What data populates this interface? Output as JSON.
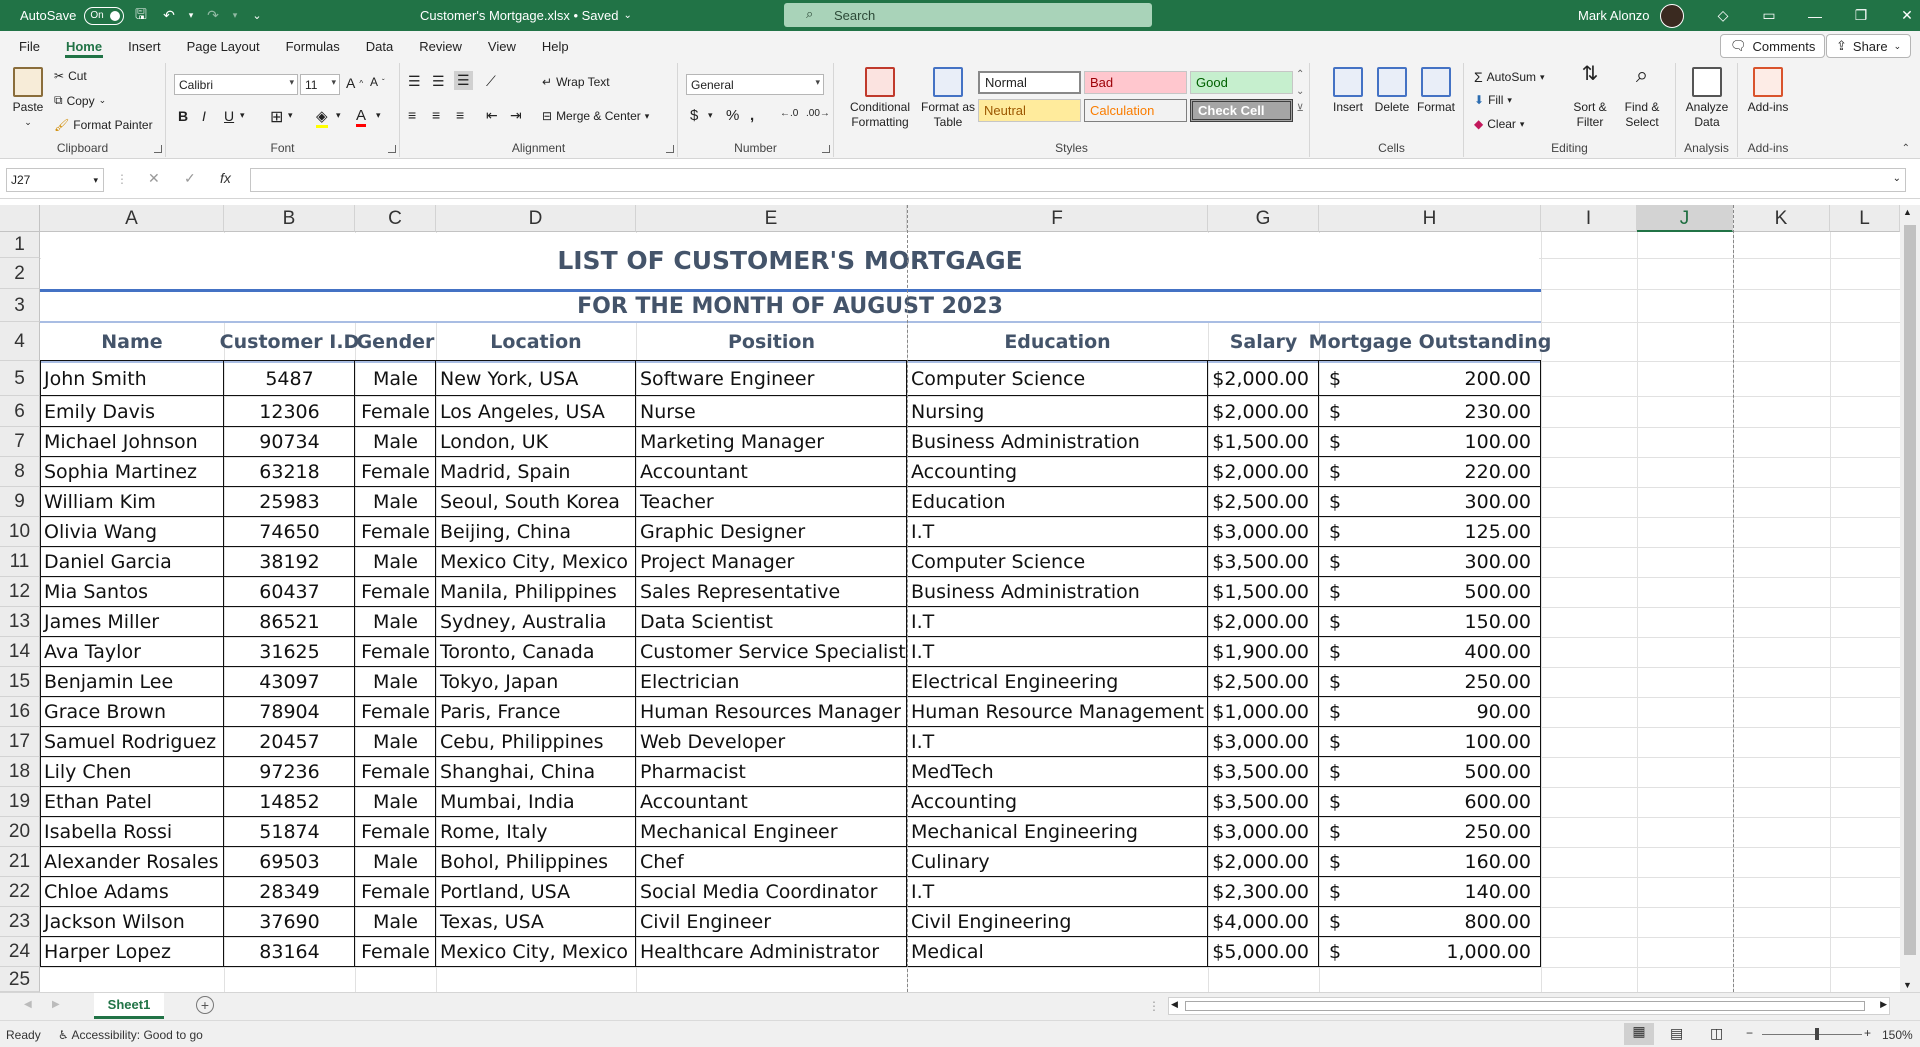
{
  "titlebar": {
    "autosave_label": "AutoSave",
    "autosave_state": "On",
    "filename": "Customer's Mortgage.xlsx • Saved",
    "search_placeholder": "Search",
    "user_name": "Mark Alonzo"
  },
  "menu": {
    "tabs": [
      "File",
      "Home",
      "Insert",
      "Page Layout",
      "Formulas",
      "Data",
      "Review",
      "View",
      "Help"
    ],
    "active_tab": "Home",
    "comments_label": "Comments",
    "share_label": "Share"
  },
  "ribbon": {
    "clipboard": {
      "paste": "Paste",
      "cut": "Cut",
      "copy": "Copy",
      "format_painter": "Format Painter",
      "label": "Clipboard"
    },
    "font": {
      "name": "Calibri",
      "size": "11",
      "label": "Font"
    },
    "alignment": {
      "wrap_text": "Wrap Text",
      "merge_center": "Merge & Center",
      "label": "Alignment"
    },
    "number": {
      "format": "General",
      "label": "Number"
    },
    "styles": {
      "conditional_formatting": "Conditional Formatting",
      "format_as_table": "Format as Table",
      "normal": "Normal",
      "bad": "Bad",
      "good": "Good",
      "neutral": "Neutral",
      "calculation": "Calculation",
      "check_cell": "Check Cell",
      "label": "Styles"
    },
    "cells": {
      "insert": "Insert",
      "delete": "Delete",
      "format": "Format",
      "label": "Cells"
    },
    "editing": {
      "autosum": "AutoSum",
      "fill": "Fill",
      "clear": "Clear",
      "sort_filter": "Sort & Filter",
      "find_select": "Find & Select",
      "label": "Editing"
    },
    "analysis": {
      "analyze_data": "Analyze Data",
      "label": "Analysis"
    },
    "addins": {
      "addins": "Add-ins",
      "label": "Add-ins"
    }
  },
  "formula_bar": {
    "name_box": "J27",
    "fx": "fx",
    "formula": ""
  },
  "sheet": {
    "columns": [
      "A",
      "B",
      "C",
      "D",
      "E",
      "F",
      "G",
      "H",
      "I",
      "J",
      "K",
      "L"
    ],
    "selected_column": "J",
    "rows": [
      "1",
      "2",
      "3",
      "4",
      "5",
      "6",
      "7",
      "8",
      "9",
      "10",
      "11",
      "12",
      "13",
      "14",
      "15",
      "16",
      "17",
      "18",
      "19",
      "20",
      "21",
      "22",
      "23",
      "24",
      "25"
    ],
    "title": "LIST OF CUSTOMER'S MORTGAGE",
    "subtitle": "FOR THE MONTH OF AUGUST 2023",
    "headers": [
      "Name",
      "Customer I.D",
      "Gender",
      "Location",
      "Position",
      "Education",
      "Salary",
      "Mortgage Outstanding"
    ],
    "currency_symbol": "$",
    "records": [
      [
        "John Smith",
        "5487",
        "Male",
        "New York, USA",
        "Software Engineer",
        "Computer Science",
        "$2,000.00",
        "200.00"
      ],
      [
        "Emily Davis",
        "12306",
        "Female",
        "Los Angeles, USA",
        "Nurse",
        "Nursing",
        "$2,000.00",
        "230.00"
      ],
      [
        "Michael Johnson",
        "90734",
        "Male",
        "London, UK",
        "Marketing Manager",
        "Business Administration",
        "$1,500.00",
        "100.00"
      ],
      [
        "Sophia Martinez",
        "63218",
        "Female",
        "Madrid, Spain",
        "Accountant",
        "Accounting",
        "$2,000.00",
        "220.00"
      ],
      [
        "William Kim",
        "25983",
        "Male",
        "Seoul, South Korea",
        "Teacher",
        "Education",
        "$2,500.00",
        "300.00"
      ],
      [
        "Olivia Wang",
        "74650",
        "Female",
        "Beijing, China",
        "Graphic Designer",
        "I.T",
        "$3,000.00",
        "125.00"
      ],
      [
        "Daniel Garcia",
        "38192",
        "Male",
        "Mexico City, Mexico",
        "Project Manager",
        "Computer Science",
        "$3,500.00",
        "300.00"
      ],
      [
        "Mia Santos",
        "60437",
        "Female",
        "Manila, Philippines",
        "Sales Representative",
        "Business Administration",
        "$1,500.00",
        "500.00"
      ],
      [
        "James Miller",
        "86521",
        "Male",
        "Sydney, Australia",
        "Data Scientist",
        "I.T",
        "$2,000.00",
        "150.00"
      ],
      [
        "Ava Taylor",
        "31625",
        "Female",
        "Toronto, Canada",
        "Customer Service Specialist",
        "I.T",
        "$1,900.00",
        "400.00"
      ],
      [
        "Benjamin Lee",
        "43097",
        "Male",
        "Tokyo, Japan",
        "Electrician",
        "Electrical Engineering",
        "$2,500.00",
        "250.00"
      ],
      [
        "Grace Brown",
        "78904",
        "Female",
        "Paris, France",
        "Human Resources Manager",
        "Human Resource Management",
        "$1,000.00",
        "90.00"
      ],
      [
        "Samuel Rodriguez",
        "20457",
        "Male",
        "Cebu, Philippines",
        "Web Developer",
        "I.T",
        "$3,000.00",
        "100.00"
      ],
      [
        "Lily Chen",
        "97236",
        "Female",
        "Shanghai, China",
        "Pharmacist",
        "MedTech",
        "$3,500.00",
        "500.00"
      ],
      [
        "Ethan Patel",
        "14852",
        "Male",
        "Mumbai, India",
        "Accountant",
        "Accounting",
        "$3,500.00",
        "600.00"
      ],
      [
        "Isabella Rossi",
        "51874",
        "Female",
        "Rome, Italy",
        "Mechanical Engineer",
        "Mechanical Engineering",
        "$3,000.00",
        "250.00"
      ],
      [
        "Alexander Rosales",
        "69503",
        "Male",
        "Bohol, Philippines",
        "Chef",
        "Culinary",
        "$2,000.00",
        "160.00"
      ],
      [
        "Chloe Adams",
        "28349",
        "Female",
        "Portland, USA",
        "Social Media Coordinator",
        "I.T",
        "$2,300.00",
        "140.00"
      ],
      [
        "Jackson Wilson",
        "37690",
        "Male",
        "Texas, USA",
        "Civil Engineer",
        "Civil Engineering",
        "$4,000.00",
        "800.00"
      ],
      [
        "Harper Lopez",
        "83164",
        "Female",
        "Mexico City, Mexico",
        "Healthcare Administrator",
        "Medical",
        "$5,000.00",
        "1,000.00"
      ]
    ]
  },
  "sheet_tabs": {
    "active": "Sheet1"
  },
  "status": {
    "ready": "Ready",
    "accessibility": "Accessibility: Good to go",
    "zoom": "150%"
  }
}
